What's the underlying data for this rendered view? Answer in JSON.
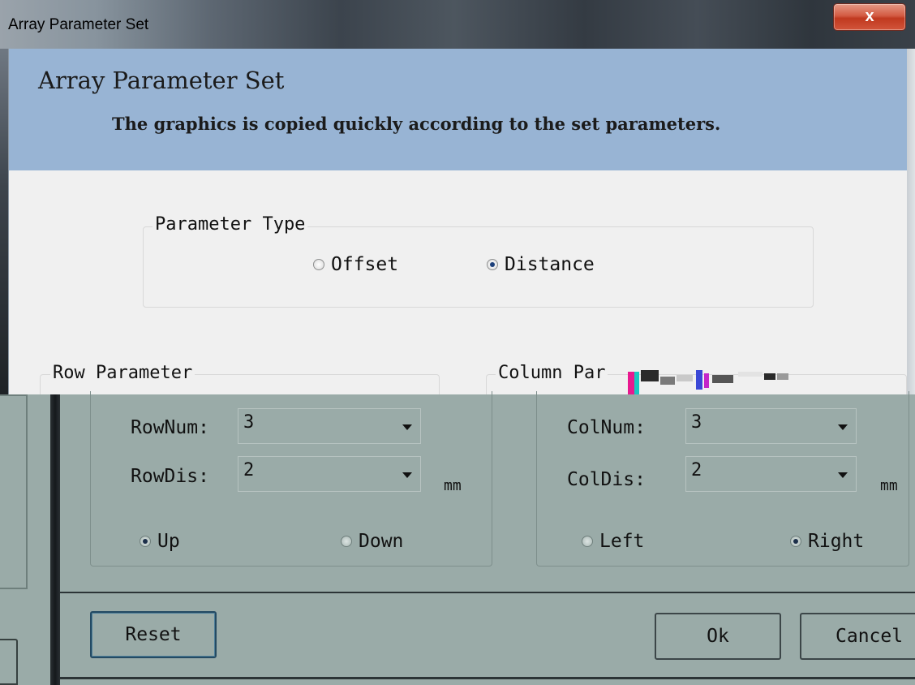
{
  "window": {
    "title": "Array Parameter Set",
    "close_glyph": "x"
  },
  "banner": {
    "title": "Array Parameter Set",
    "subtitle": "The graphics is copied quickly according to the set parameters."
  },
  "parameter_type": {
    "legend": "Parameter Type",
    "options": [
      {
        "label": "Offset",
        "selected": false
      },
      {
        "label": "Distance",
        "selected": true
      }
    ]
  },
  "row": {
    "legend": "Row Parameter",
    "num_label": "RowNum:",
    "num_value": "3",
    "dis_label": "RowDis:",
    "dis_value": "2",
    "unit": "mm",
    "directions": [
      {
        "label": "Up",
        "selected": true
      },
      {
        "label": "Down",
        "selected": false
      }
    ]
  },
  "column": {
    "legend": "Column Par",
    "num_label": "ColNum:",
    "num_value": "3",
    "dis_label": "ColDis:",
    "dis_value": "2",
    "unit": "mm",
    "directions": [
      {
        "label": "Left",
        "selected": false
      },
      {
        "label": "Right",
        "selected": true
      }
    ]
  },
  "buttons": {
    "reset": "Reset",
    "ok": "Ok",
    "cancel": "Cancel"
  },
  "icons": {
    "close": "close-icon",
    "radio": "radio-icon",
    "dropdown": "chevron-down-icon"
  },
  "colors": {
    "banner": "#98b4d4",
    "lower_tint": "#9aaba8",
    "close": "#c0391f"
  }
}
